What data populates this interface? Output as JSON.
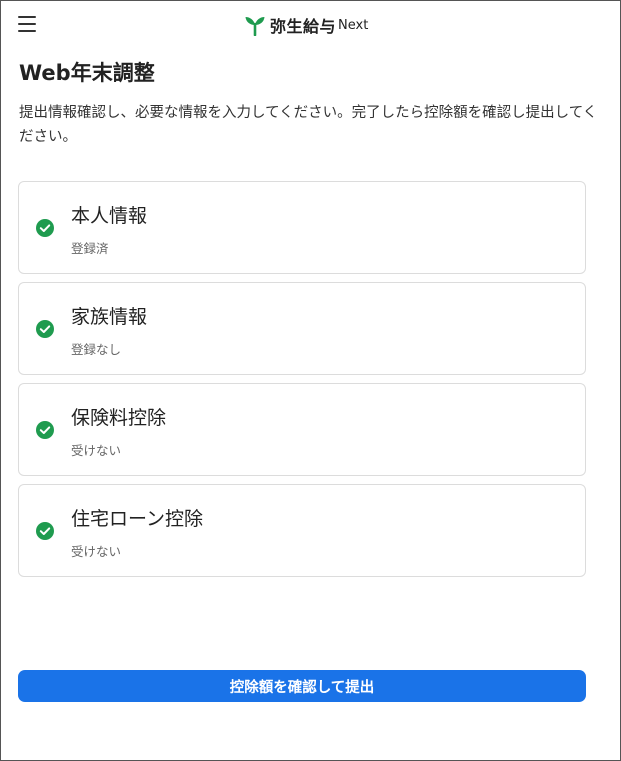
{
  "header": {
    "menu_icon": "hamburger-menu-icon",
    "logo_icon": "sprout-icon",
    "logo_text": "弥生給与",
    "logo_suffix": "Next",
    "brand_color": "#1f9b4f"
  },
  "page": {
    "title": "Web年末調整",
    "description": "提出情報確認し、必要な情報を入力してください。完了したら控除額を確認し提出してください。"
  },
  "sections": [
    {
      "title": "本人情報",
      "status": "登録済",
      "icon": "check-circle-icon"
    },
    {
      "title": "家族情報",
      "status": "登録なし",
      "icon": "check-circle-icon"
    },
    {
      "title": "保険料控除",
      "status": "受けない",
      "icon": "check-circle-icon"
    },
    {
      "title": "住宅ローン控除",
      "status": "受けない",
      "icon": "check-circle-icon"
    }
  ],
  "actions": {
    "submit_label": "控除額を確認して提出",
    "submit_color": "#1a73e8"
  }
}
